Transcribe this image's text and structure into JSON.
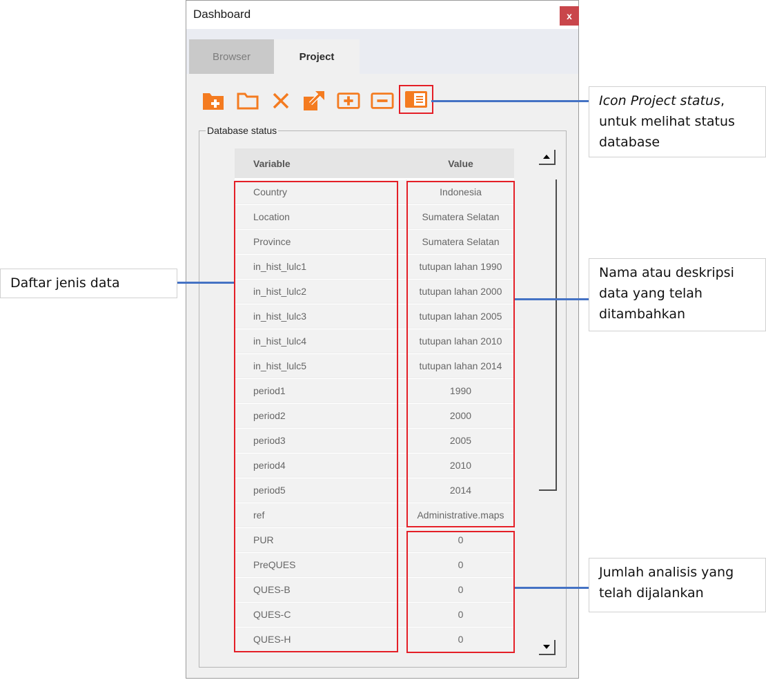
{
  "window": {
    "title": "Dashboard",
    "close_label": "x"
  },
  "tabs": [
    {
      "label": "Browser",
      "active": false
    },
    {
      "label": "Project",
      "active": true
    }
  ],
  "toolbar": {
    "accent_color": "#f47b20",
    "icons": [
      "new-folder-icon",
      "open-folder-icon",
      "delete-icon",
      "export-icon",
      "add-icon",
      "remove-icon",
      "project-status-icon"
    ]
  },
  "database_status": {
    "group_label": "Database status",
    "columns": [
      "Variable",
      "Value"
    ],
    "rows": [
      {
        "variable": "Country",
        "value": "Indonesia"
      },
      {
        "variable": "Location",
        "value": "Sumatera Selatan"
      },
      {
        "variable": "Province",
        "value": "Sumatera Selatan"
      },
      {
        "variable": "in_hist_lulc1",
        "value": "tutupan lahan 1990"
      },
      {
        "variable": "in_hist_lulc2",
        "value": "tutupan lahan 2000"
      },
      {
        "variable": "in_hist_lulc3",
        "value": "tutupan lahan 2005"
      },
      {
        "variable": "in_hist_lulc4",
        "value": "tutupan lahan 2010"
      },
      {
        "variable": "in_hist_lulc5",
        "value": "tutupan lahan 2014"
      },
      {
        "variable": "period1",
        "value": "1990"
      },
      {
        "variable": "period2",
        "value": "2000"
      },
      {
        "variable": "period3",
        "value": "2005"
      },
      {
        "variable": "period4",
        "value": "2010"
      },
      {
        "variable": "period5",
        "value": "2014"
      },
      {
        "variable": "ref",
        "value": "Administrative.maps"
      },
      {
        "variable": "PUR",
        "value": "0"
      },
      {
        "variable": "PreQUES",
        "value": "0"
      },
      {
        "variable": "QUES-B",
        "value": "0"
      },
      {
        "variable": "QUES-C",
        "value": "0"
      },
      {
        "variable": "QUES-H",
        "value": "0"
      }
    ]
  },
  "annotations": {
    "project_status": {
      "italic": "Icon Project status",
      "rest": ", untuk melihat status database"
    },
    "data_types": "Daftar jenis data",
    "data_description": "Nama atau deskripsi data yang telah ditambahkan",
    "analysis_count": "Jumlah analisis yang telah dijalankan"
  },
  "colors": {
    "highlight": "#e41e26",
    "connector": "#4472c4",
    "close_button": "#c9464b"
  }
}
